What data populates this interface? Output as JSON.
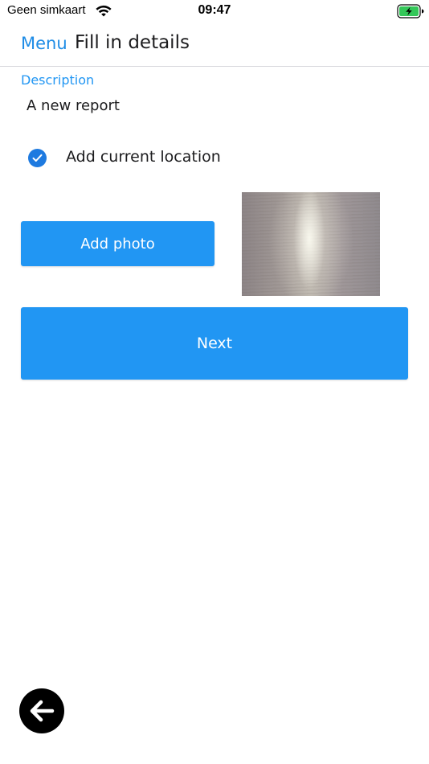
{
  "status_bar": {
    "carrier": "Geen simkaart",
    "time": "09:47",
    "wifi_icon": "wifi-icon",
    "battery_icon": "battery-charging-icon",
    "battery_color": "#34c759"
  },
  "nav": {
    "menu_label": "Menu",
    "title": "Fill in details"
  },
  "form": {
    "description_label": "Description",
    "description_value": "A new report",
    "location_label": "Add current location",
    "location_checked": true,
    "add_photo_label": "Add photo",
    "next_label": "Next"
  },
  "fab": {
    "icon": "arrow-left-icon"
  },
  "colors": {
    "accent": "#2196f3",
    "link": "#1e8ce6",
    "check": "#1e7ae0"
  }
}
